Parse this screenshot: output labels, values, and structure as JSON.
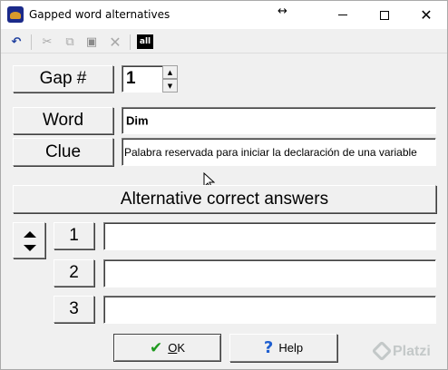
{
  "window": {
    "title": "Gapped word alternatives",
    "resize_icon": "↔"
  },
  "toolbar": {
    "undo_icon": "undo-icon",
    "cut_icon": "cut-icon",
    "copy_icon": "copy-icon",
    "paste_icon": "paste-icon",
    "delete_icon": "delete-icon",
    "select_all_label": "all"
  },
  "form": {
    "gap_label": "Gap #",
    "gap_value": "1",
    "word_label": "Word",
    "word_value": "Dim",
    "clue_label": "Clue",
    "clue_value": "Palabra reservada para iniciar la declaración de una variable"
  },
  "alternatives": {
    "header": "Alternative correct answers",
    "rows": [
      {
        "number": "1",
        "value": ""
      },
      {
        "number": "2",
        "value": ""
      },
      {
        "number": "3",
        "value": ""
      }
    ]
  },
  "buttons": {
    "ok_label": "OK",
    "help_label": "Help"
  },
  "watermark": "Platzi"
}
